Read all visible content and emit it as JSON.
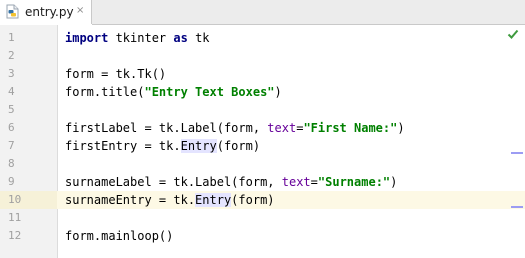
{
  "tab": {
    "filename": "entry.py",
    "close_glyph": "×",
    "icon": "python-file-icon"
  },
  "status": {
    "icon": "check-icon",
    "color": "#3e9a3e"
  },
  "colors": {
    "keyword": "#000080",
    "string": "#008000",
    "parameter": "#660099",
    "current_line": "#fdf9e5",
    "usage_highlight": "#e4e4ff"
  },
  "editor": {
    "current_line": 10,
    "lines": [
      {
        "num": "1",
        "tokens": [
          {
            "t": "import",
            "c": "kw"
          },
          {
            "t": " tkinter "
          },
          {
            "t": "as",
            "c": "kw"
          },
          {
            "t": " tk"
          }
        ]
      },
      {
        "num": "2",
        "tokens": []
      },
      {
        "num": "3",
        "tokens": [
          {
            "t": "form = tk.Tk()"
          }
        ]
      },
      {
        "num": "4",
        "tokens": [
          {
            "t": "form.title("
          },
          {
            "t": "\"Entry Text Boxes\"",
            "c": "str"
          },
          {
            "t": ")"
          }
        ]
      },
      {
        "num": "5",
        "tokens": []
      },
      {
        "num": "6",
        "tokens": [
          {
            "t": "firstLabel = tk.Label(form, "
          },
          {
            "t": "text",
            "c": "param"
          },
          {
            "t": "="
          },
          {
            "t": "\"First Name:\"",
            "c": "str"
          },
          {
            "t": ")"
          }
        ]
      },
      {
        "num": "7",
        "tokens": [
          {
            "t": "firstEntry = tk."
          },
          {
            "t": "Entry",
            "c": "hl"
          },
          {
            "t": "(form)"
          }
        ]
      },
      {
        "num": "8",
        "tokens": []
      },
      {
        "num": "9",
        "tokens": [
          {
            "t": "surnameLabel = tk.Label(form, "
          },
          {
            "t": "text",
            "c": "param"
          },
          {
            "t": "="
          },
          {
            "t": "\"Surname:\"",
            "c": "str"
          },
          {
            "t": ")"
          }
        ]
      },
      {
        "num": "10",
        "tokens": [
          {
            "t": "surnameEntry = tk."
          },
          {
            "t": "Entry",
            "c": "hl"
          },
          {
            "t": "(form)"
          }
        ]
      },
      {
        "num": "11",
        "tokens": []
      },
      {
        "num": "12",
        "tokens": [
          {
            "t": "form.mainloop()"
          }
        ]
      }
    ]
  }
}
